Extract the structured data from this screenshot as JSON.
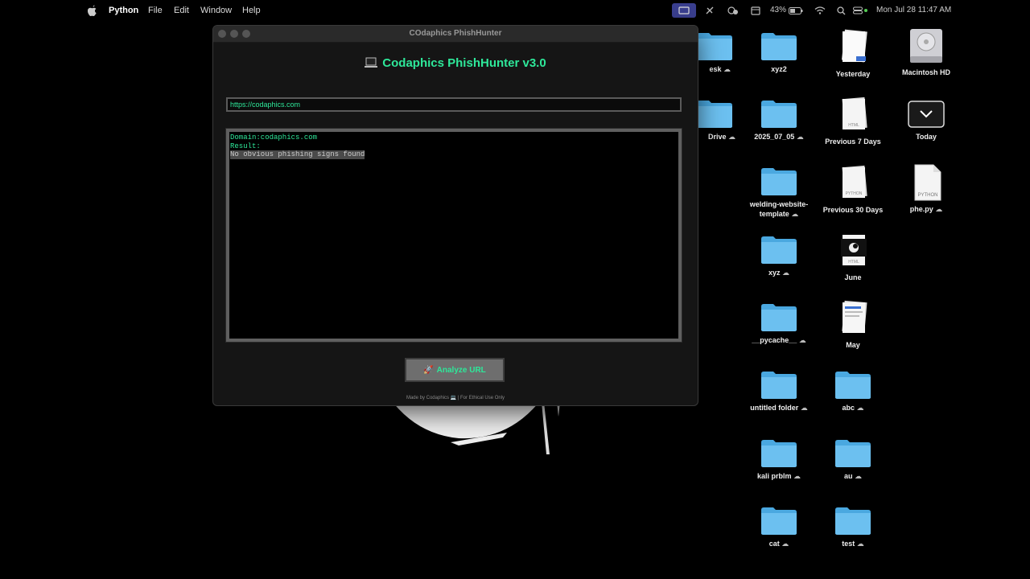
{
  "menubar": {
    "app_name": "Python",
    "items": [
      "File",
      "Edit",
      "Window",
      "Help"
    ],
    "battery": "43%",
    "datetime": "Mon Jul 28  11:47 AM"
  },
  "window": {
    "title": "COdaphics PhishHunter",
    "app_heading": "Codaphics PhishHunter v3.0",
    "url_value": "https://codaphics.com",
    "output": {
      "line1": "Domain:codaphics.com",
      "line2": "Result:",
      "line3": "No obvious phishing signs found"
    },
    "analyze_label": "Analyze URL",
    "footer": "Made by Codaphics 💻 | For Ethical Use Only"
  },
  "desktop": {
    "col_partial": [
      {
        "label": "esk",
        "cloud": true
      },
      {
        "label": "Drive",
        "cloud": true
      }
    ],
    "icons": [
      {
        "label": "xyz2",
        "type": "folder",
        "cloud": false
      },
      {
        "label": "Yesterday",
        "type": "stack",
        "cloud": false
      },
      {
        "label": "Macintosh HD",
        "type": "disk",
        "cloud": false
      },
      {
        "label": "2025_07_05",
        "type": "folder",
        "cloud": true
      },
      {
        "label": "Previous 7 Days",
        "type": "stack",
        "cloud": false
      },
      {
        "label": "Today",
        "type": "today",
        "cloud": false
      },
      {
        "label": "welding-website-template",
        "type": "folder",
        "cloud": true
      },
      {
        "label": "Previous 30 Days",
        "type": "stack",
        "cloud": false
      },
      {
        "label": "phe.py",
        "type": "pyfile",
        "cloud": true
      },
      {
        "label": "xyz",
        "type": "folder",
        "cloud": true
      },
      {
        "label": "June",
        "type": "stack",
        "cloud": false
      },
      {
        "label": "__pycache__",
        "type": "folder",
        "cloud": true
      },
      {
        "label": "May",
        "type": "stack",
        "cloud": false
      },
      {
        "label": "untitled folder",
        "type": "folder",
        "cloud": true
      },
      {
        "label": "abc",
        "type": "folder",
        "cloud": true
      },
      {
        "label": "kali prblm",
        "type": "folder",
        "cloud": true
      },
      {
        "label": "au",
        "type": "folder",
        "cloud": true
      },
      {
        "label": "cat",
        "type": "folder",
        "cloud": true
      },
      {
        "label": "test",
        "type": "folder",
        "cloud": true
      }
    ]
  }
}
